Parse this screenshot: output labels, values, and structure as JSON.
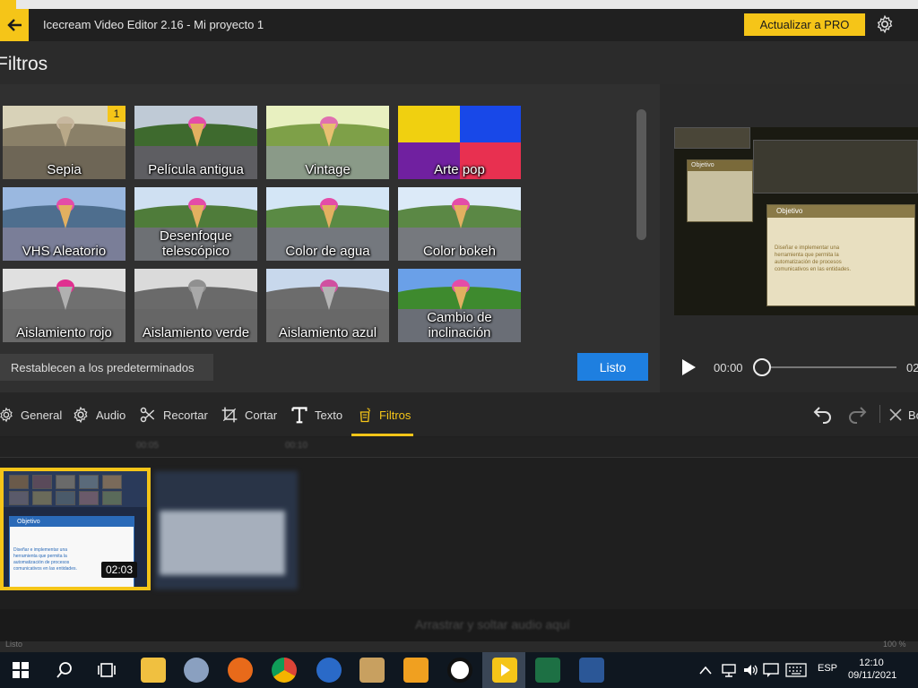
{
  "window": {
    "title": "Icecream Video Editor 2.16  -  Mi proyecto 1",
    "pro_button": "Actualizar a PRO"
  },
  "page": {
    "title": "Filtros"
  },
  "filters": [
    {
      "label": "Sepia",
      "selected": true,
      "badge": "1"
    },
    {
      "label": "Película antigua"
    },
    {
      "label": "Vintage"
    },
    {
      "label": "Arte pop"
    },
    {
      "label": "VHS Aleatorio"
    },
    {
      "label": "Desenfoque telescópico"
    },
    {
      "label": "Color de agua"
    },
    {
      "label": "Color bokeh"
    },
    {
      "label": "Aislamiento rojo"
    },
    {
      "label": "Aislamiento verde"
    },
    {
      "label": "Aislamiento azul"
    },
    {
      "label": "Cambio de inclinación"
    }
  ],
  "actions": {
    "reset": "Restablecen a los predeterminados",
    "done": "Listo"
  },
  "player": {
    "current_time": "00:00",
    "end_time": "02",
    "progress": 0
  },
  "preview": {
    "slide_title_back": "Objetivo",
    "slide_title_front": "Objetivo",
    "slide_text": "Diseñar e implementar una herramienta que permita la automatización de procesos comunicativos en las entidades."
  },
  "toolbar": {
    "general": "General",
    "audio": "Audio",
    "crop": "Recortar",
    "cut": "Cortar",
    "text": "Texto",
    "filters": "Filtros",
    "delete": "Bo"
  },
  "timeline": {
    "ruler": [
      "00:05",
      "00:10"
    ],
    "clip1_duration": "02:03",
    "clip1_slide_title": "Objetivo",
    "clip1_slide_text": "Diseñar e implementar una herramienta que permita la automatización de procesos comunicativos en las entidades.",
    "audio_hint": "Arrastrar y soltar audio aquí"
  },
  "status": {
    "left": "Listo",
    "right": "100 %"
  },
  "taskbar": {
    "language": "ESP",
    "time": "12:10",
    "date": "09/11/2021"
  },
  "colors": {
    "accent": "#f5c518",
    "primary_button": "#1e7fe0"
  }
}
